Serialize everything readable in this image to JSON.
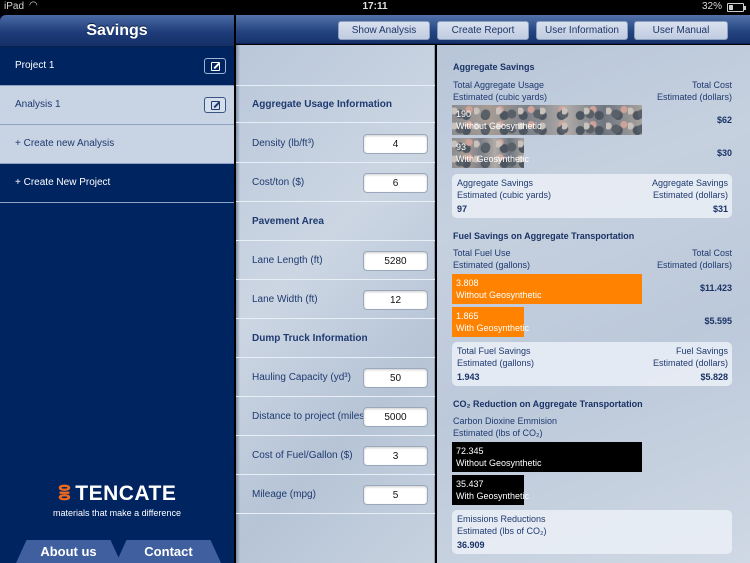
{
  "status_bar": {
    "device": "iPad",
    "wifi_icon": "wifi-icon",
    "time": "17:11",
    "battery_percent": "32%",
    "battery_level": 0.32
  },
  "sidebar": {
    "title": "Savings",
    "items": [
      {
        "label": "Project 1",
        "style": "dark",
        "edit_icon": "edit-icon"
      },
      {
        "label": "Analysis 1",
        "style": "light",
        "edit_icon": "edit-icon"
      },
      {
        "label": "+ Create new Analysis",
        "style": "light"
      },
      {
        "label": "+ Create New Project",
        "style": "dark"
      }
    ],
    "logo": {
      "mark": "ꝏ",
      "name": "TENCATE",
      "tagline": "materials that make a difference"
    },
    "tabs": [
      "About us",
      "Contact"
    ]
  },
  "toolbar": {
    "buttons": [
      "Show Analysis",
      "Create Report",
      "User Information",
      "User Manual"
    ]
  },
  "inputs": {
    "sections": [
      {
        "header": "Aggregate Usage Information",
        "fields": [
          {
            "label": "Density (lb/ft³)",
            "value": "4"
          },
          {
            "label": "Cost/ton ($)",
            "value": "6"
          }
        ]
      },
      {
        "header": "Pavement Area",
        "fields": [
          {
            "label": "Lane Length (ft)",
            "value": "5280"
          },
          {
            "label": "Lane Width (ft)",
            "value": "12"
          }
        ]
      },
      {
        "header": "Dump Truck Information",
        "fields": [
          {
            "label": "Hauling Capacity (yd³)",
            "value": "50"
          },
          {
            "label": "Distance to project (miles)",
            "value": "5000"
          },
          {
            "label": "Cost of Fuel/Gallon ($)",
            "value": "3"
          },
          {
            "label": "Mileage (mpg)",
            "value": "5"
          }
        ]
      }
    ]
  },
  "results": {
    "aggregate": {
      "title": "Aggregate Savings",
      "left_head": [
        "Total Aggregate Usage",
        "Estimated (cubic yards)"
      ],
      "right_head": [
        "Total Cost",
        "Estimated (dollars)"
      ],
      "bars": [
        {
          "value": "190",
          "label": "Without Geosynthetic",
          "cost": "$62",
          "fraction": 1.0
        },
        {
          "value": "93",
          "label": "With Geosynthetic",
          "cost": "$30",
          "fraction": 0.38
        }
      ],
      "summary": {
        "left": [
          "Aggregate Savings",
          "Estimated (cubic yards)"
        ],
        "right": [
          "Aggregate Savings",
          "Estimated (dollars)"
        ],
        "left_value": "97",
        "right_value": "$31"
      }
    },
    "fuel": {
      "title": "Fuel Savings on Aggregate Transportation",
      "left_head": [
        "Total Fuel Use",
        "Estimated (gallons)"
      ],
      "right_head": [
        "Total Cost",
        "Estimated (dollars)"
      ],
      "bars": [
        {
          "value": "3.808",
          "label": "Without Geosynthetic",
          "cost": "$11.423",
          "fraction": 1.0
        },
        {
          "value": "1.865",
          "label": "With Geosynthetic",
          "cost": "$5.595",
          "fraction": 0.38
        },
        "placeholder"
      ],
      "summary": {
        "left": [
          "Total Fuel Savings",
          "Estimated (gallons)"
        ],
        "right": [
          "Fuel Savings",
          "Estimated (dollars)"
        ],
        "left_value": "1.943",
        "right_value": "$5.828"
      }
    },
    "co2": {
      "title": "CO₂ Reduction on Aggregate Transportation",
      "left_head": [
        "Carbon Dioxine Emmision",
        "Estimated (lbs of CO₂)"
      ],
      "bars": [
        {
          "value": "72.345",
          "label": "Without Geosynthetic",
          "fraction": 1.0
        },
        {
          "value": "35.437",
          "label": "With Geosynthetic",
          "fraction": 0.38
        }
      ],
      "summary": {
        "left": [
          "Emissions Reductions",
          "Estimated (lbs of CO₂)"
        ],
        "left_value": "36.909"
      }
    },
    "colors": {
      "fuel_bar": "#ff8200",
      "co2_bar": "#000000",
      "title": "#1a3366",
      "sidebar": "#002460"
    }
  }
}
